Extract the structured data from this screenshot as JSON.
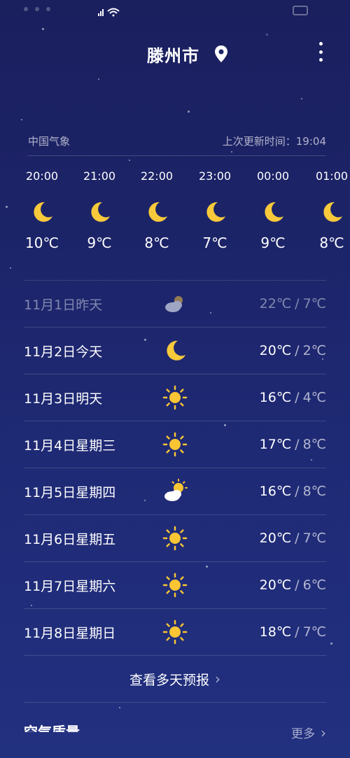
{
  "status_bar": {
    "signal_icon": "signal-icon",
    "wifi_icon": "wifi-icon",
    "battery_icon": "battery-icon"
  },
  "header": {
    "city": "滕州市",
    "location_icon": "location-pin-icon",
    "menu_icon": "more-vertical-icon"
  },
  "source": {
    "provider": "中国气象",
    "updated": "上次更新时间：19:04"
  },
  "hourly": [
    {
      "time": "20:00",
      "icon": "moon-icon",
      "temp": "10℃"
    },
    {
      "time": "21:00",
      "icon": "moon-icon",
      "temp": "9℃"
    },
    {
      "time": "22:00",
      "icon": "moon-icon",
      "temp": "8℃"
    },
    {
      "time": "23:00",
      "icon": "moon-icon",
      "temp": "7℃"
    },
    {
      "time": "00:00",
      "icon": "moon-icon",
      "temp": "9℃"
    },
    {
      "time": "01:00",
      "icon": "moon-icon",
      "temp": "8℃"
    }
  ],
  "daily": [
    {
      "date": "11月1日昨天",
      "icon": "cloudy-icon",
      "high": "22℃",
      "low": "7℃",
      "past": true
    },
    {
      "date": "11月2日今天",
      "icon": "moon-icon",
      "high": "20℃",
      "low": "2℃",
      "past": false
    },
    {
      "date": "11月3日明天",
      "icon": "sun-icon",
      "high": "16℃",
      "low": "4℃",
      "past": false
    },
    {
      "date": "11月4日星期三",
      "icon": "sun-icon",
      "high": "17℃",
      "low": "8℃",
      "past": false
    },
    {
      "date": "11月5日星期四",
      "icon": "partly-cloudy-icon",
      "high": "16℃",
      "low": "8℃",
      "past": false
    },
    {
      "date": "11月6日星期五",
      "icon": "sun-icon",
      "high": "20℃",
      "low": "7℃",
      "past": false
    },
    {
      "date": "11月7日星期六",
      "icon": "sun-icon",
      "high": "20℃",
      "low": "6℃",
      "past": false
    },
    {
      "date": "11月8日星期日",
      "icon": "sun-icon",
      "high": "18℃",
      "low": "7℃",
      "past": false
    }
  ],
  "more_days_label": "查看多天预报",
  "air_quality": {
    "title": "空气质量",
    "more": "更多"
  },
  "colors": {
    "moon": "#f7c93b",
    "sun": "#f9c534",
    "background_top": "#1a1f5e",
    "background_bottom": "#223080"
  }
}
